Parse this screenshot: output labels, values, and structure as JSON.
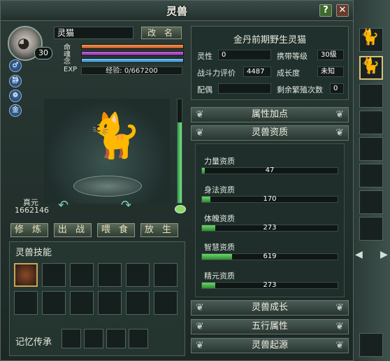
{
  "window": {
    "title": "灵兽"
  },
  "title_buttons": {
    "help": "?",
    "close": "✕"
  },
  "pet": {
    "name": "灵猫",
    "level": "30",
    "rename_label": "改 名",
    "stats": {
      "life_label": "命",
      "soul_label": "魂",
      "mind_label": "念",
      "exp_label": "EXP",
      "exp_text": "经验: 0/667200"
    },
    "zhenyuan_label": "真元",
    "zhenyuan_value": "1662146",
    "growth_level": 0.78
  },
  "side_icons": [
    "♂",
    "静",
    "❁",
    "金"
  ],
  "actions": {
    "cultivate": "修 炼",
    "deploy": "出 战",
    "feed": "喂 食",
    "release": "放 生"
  },
  "skills": {
    "title": "灵兽技能",
    "memory_label": "记忆传承"
  },
  "info": {
    "header": "金丹前期野生灵猫",
    "spirit_label": "灵性",
    "spirit_value": "0",
    "carry_label": "携带等级",
    "carry_value": "30级",
    "power_label": "战斗力评价",
    "power_value": "4487",
    "growth_label": "成长度",
    "growth_value": "未知",
    "mate_label": "配偶",
    "mate_value": "",
    "breed_label": "剩余繁殖次数",
    "breed_value": "0"
  },
  "sections": {
    "attr_points": "属性加点",
    "aptitude": "灵兽资质",
    "growth": "灵兽成长",
    "five_elements": "五行属性",
    "origin": "灵兽起源"
  },
  "aptitudes": [
    {
      "label": "力量资质",
      "value": "47",
      "fill": 0.02
    },
    {
      "label": "身法资质",
      "value": "170",
      "fill": 0.06
    },
    {
      "label": "体魄资质",
      "value": "273",
      "fill": 0.1
    },
    {
      "label": "智慧资质",
      "value": "619",
      "fill": 0.22
    },
    {
      "label": "精元资质",
      "value": "273",
      "fill": 0.1
    }
  ]
}
